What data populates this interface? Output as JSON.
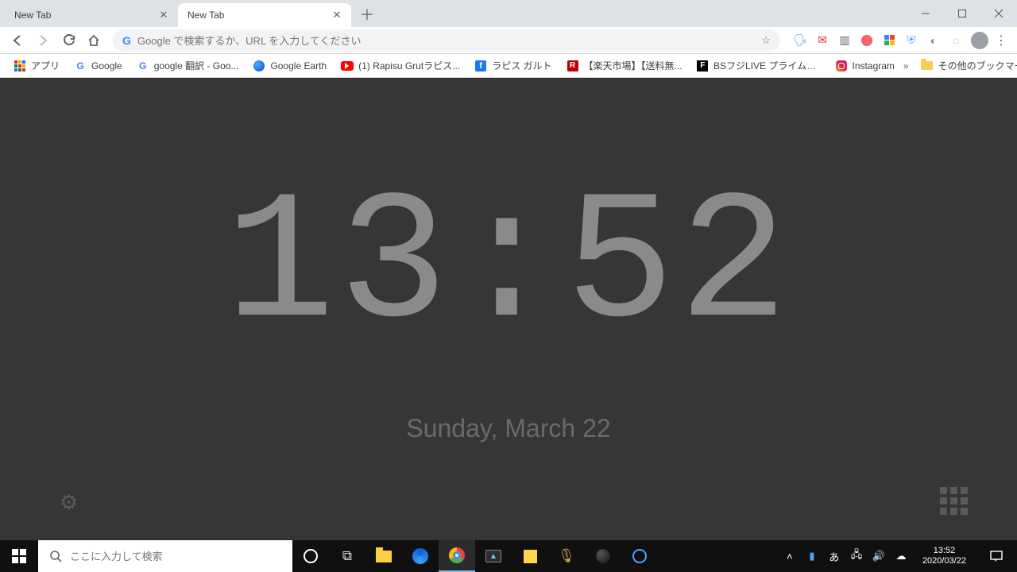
{
  "tabs": [
    {
      "title": "New Tab",
      "active": false
    },
    {
      "title": "New Tab",
      "active": true
    }
  ],
  "omnibox": {
    "placeholder": "Google で検索するか、URL を入力してください"
  },
  "bookmarks": {
    "items": [
      {
        "label": "アプリ"
      },
      {
        "label": "Google"
      },
      {
        "label": "google 翻訳 - Goo..."
      },
      {
        "label": "Google Earth"
      },
      {
        "label": "(1) Rapisu Grutラピス..."
      },
      {
        "label": "ラピス ガルト"
      },
      {
        "label": "【楽天市場】【送料無..."
      },
      {
        "label": "BSフジLIVE プライムニ..."
      },
      {
        "label": "Instagram"
      }
    ],
    "other": "その他のブックマーク"
  },
  "newtab": {
    "time": "13:52",
    "date": "Sunday, March 22"
  },
  "taskbar": {
    "search_placeholder": "ここに入力して検索",
    "clock_time": "13:52",
    "clock_date": "2020/03/22"
  }
}
